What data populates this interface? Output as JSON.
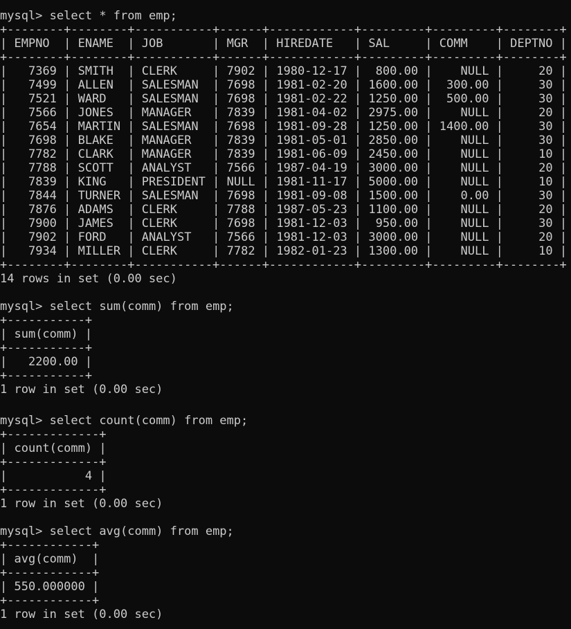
{
  "terminal": {
    "prompt": "mysql>",
    "block1": {
      "command": "select * from emp;",
      "border": "+--------+--------+-----------+------+------------+---------+---------+--------+",
      "headers": [
        "EMPNO",
        "ENAME",
        "JOB",
        "MGR",
        "HIREDATE",
        "SAL",
        "COMM",
        "DEPTNO"
      ],
      "rows": [
        [
          "7369",
          "SMITH",
          "CLERK",
          "7902",
          "1980-12-17",
          "800.00",
          "NULL",
          "20"
        ],
        [
          "7499",
          "ALLEN",
          "SALESMAN",
          "7698",
          "1981-02-20",
          "1600.00",
          "300.00",
          "30"
        ],
        [
          "7521",
          "WARD",
          "SALESMAN",
          "7698",
          "1981-02-22",
          "1250.00",
          "500.00",
          "30"
        ],
        [
          "7566",
          "JONES",
          "MANAGER",
          "7839",
          "1981-04-02",
          "2975.00",
          "NULL",
          "20"
        ],
        [
          "7654",
          "MARTIN",
          "SALESMAN",
          "7698",
          "1981-09-28",
          "1250.00",
          "1400.00",
          "30"
        ],
        [
          "7698",
          "BLAKE",
          "MANAGER",
          "7839",
          "1981-05-01",
          "2850.00",
          "NULL",
          "30"
        ],
        [
          "7782",
          "CLARK",
          "MANAGER",
          "7839",
          "1981-06-09",
          "2450.00",
          "NULL",
          "10"
        ],
        [
          "7788",
          "SCOTT",
          "ANALYST",
          "7566",
          "1987-04-19",
          "3000.00",
          "NULL",
          "20"
        ],
        [
          "7839",
          "KING",
          "PRESIDENT",
          "NULL",
          "1981-11-17",
          "5000.00",
          "NULL",
          "10"
        ],
        [
          "7844",
          "TURNER",
          "SALESMAN",
          "7698",
          "1981-09-08",
          "1500.00",
          "0.00",
          "30"
        ],
        [
          "7876",
          "ADAMS",
          "CLERK",
          "7788",
          "1987-05-23",
          "1100.00",
          "NULL",
          "20"
        ],
        [
          "7900",
          "JAMES",
          "CLERK",
          "7698",
          "1981-12-03",
          "950.00",
          "NULL",
          "30"
        ],
        [
          "7902",
          "FORD",
          "ANALYST",
          "7566",
          "1981-12-03",
          "3000.00",
          "NULL",
          "20"
        ],
        [
          "7934",
          "MILLER",
          "CLERK",
          "7782",
          "1982-01-23",
          "1300.00",
          "NULL",
          "10"
        ]
      ],
      "status": "14 rows in set (0.00 sec)"
    },
    "block2": {
      "command": "select sum(comm) from emp;",
      "border": "+-----------+",
      "header": "sum(comm)",
      "value": "2200.00",
      "status": "1 row in set (0.00 sec)"
    },
    "block3": {
      "command": "select count(comm) from emp;",
      "border": "+-------------+",
      "header": "count(comm)",
      "value": "4",
      "status": "1 row in set (0.00 sec)"
    },
    "block4": {
      "command": "select avg(comm) from emp;",
      "border": "+------------+",
      "header": "avg(comm)",
      "value": "550.000000",
      "status": "1 row in set (0.00 sec)"
    }
  }
}
